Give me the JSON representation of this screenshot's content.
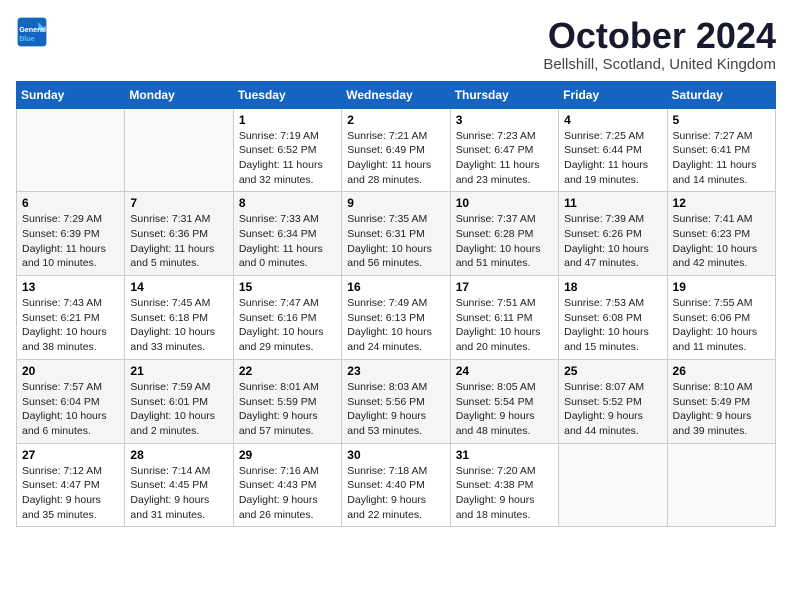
{
  "logo": {
    "line1": "General",
    "line2": "Blue"
  },
  "title": "October 2024",
  "location": "Bellshill, Scotland, United Kingdom",
  "days_of_week": [
    "Sunday",
    "Monday",
    "Tuesday",
    "Wednesday",
    "Thursday",
    "Friday",
    "Saturday"
  ],
  "weeks": [
    [
      {
        "day": "",
        "info": ""
      },
      {
        "day": "",
        "info": ""
      },
      {
        "day": "1",
        "info": "Sunrise: 7:19 AM\nSunset: 6:52 PM\nDaylight: 11 hours\nand 32 minutes."
      },
      {
        "day": "2",
        "info": "Sunrise: 7:21 AM\nSunset: 6:49 PM\nDaylight: 11 hours\nand 28 minutes."
      },
      {
        "day": "3",
        "info": "Sunrise: 7:23 AM\nSunset: 6:47 PM\nDaylight: 11 hours\nand 23 minutes."
      },
      {
        "day": "4",
        "info": "Sunrise: 7:25 AM\nSunset: 6:44 PM\nDaylight: 11 hours\nand 19 minutes."
      },
      {
        "day": "5",
        "info": "Sunrise: 7:27 AM\nSunset: 6:41 PM\nDaylight: 11 hours\nand 14 minutes."
      }
    ],
    [
      {
        "day": "6",
        "info": "Sunrise: 7:29 AM\nSunset: 6:39 PM\nDaylight: 11 hours\nand 10 minutes."
      },
      {
        "day": "7",
        "info": "Sunrise: 7:31 AM\nSunset: 6:36 PM\nDaylight: 11 hours\nand 5 minutes."
      },
      {
        "day": "8",
        "info": "Sunrise: 7:33 AM\nSunset: 6:34 PM\nDaylight: 11 hours\nand 0 minutes."
      },
      {
        "day": "9",
        "info": "Sunrise: 7:35 AM\nSunset: 6:31 PM\nDaylight: 10 hours\nand 56 minutes."
      },
      {
        "day": "10",
        "info": "Sunrise: 7:37 AM\nSunset: 6:28 PM\nDaylight: 10 hours\nand 51 minutes."
      },
      {
        "day": "11",
        "info": "Sunrise: 7:39 AM\nSunset: 6:26 PM\nDaylight: 10 hours\nand 47 minutes."
      },
      {
        "day": "12",
        "info": "Sunrise: 7:41 AM\nSunset: 6:23 PM\nDaylight: 10 hours\nand 42 minutes."
      }
    ],
    [
      {
        "day": "13",
        "info": "Sunrise: 7:43 AM\nSunset: 6:21 PM\nDaylight: 10 hours\nand 38 minutes."
      },
      {
        "day": "14",
        "info": "Sunrise: 7:45 AM\nSunset: 6:18 PM\nDaylight: 10 hours\nand 33 minutes."
      },
      {
        "day": "15",
        "info": "Sunrise: 7:47 AM\nSunset: 6:16 PM\nDaylight: 10 hours\nand 29 minutes."
      },
      {
        "day": "16",
        "info": "Sunrise: 7:49 AM\nSunset: 6:13 PM\nDaylight: 10 hours\nand 24 minutes."
      },
      {
        "day": "17",
        "info": "Sunrise: 7:51 AM\nSunset: 6:11 PM\nDaylight: 10 hours\nand 20 minutes."
      },
      {
        "day": "18",
        "info": "Sunrise: 7:53 AM\nSunset: 6:08 PM\nDaylight: 10 hours\nand 15 minutes."
      },
      {
        "day": "19",
        "info": "Sunrise: 7:55 AM\nSunset: 6:06 PM\nDaylight: 10 hours\nand 11 minutes."
      }
    ],
    [
      {
        "day": "20",
        "info": "Sunrise: 7:57 AM\nSunset: 6:04 PM\nDaylight: 10 hours\nand 6 minutes."
      },
      {
        "day": "21",
        "info": "Sunrise: 7:59 AM\nSunset: 6:01 PM\nDaylight: 10 hours\nand 2 minutes."
      },
      {
        "day": "22",
        "info": "Sunrise: 8:01 AM\nSunset: 5:59 PM\nDaylight: 9 hours\nand 57 minutes."
      },
      {
        "day": "23",
        "info": "Sunrise: 8:03 AM\nSunset: 5:56 PM\nDaylight: 9 hours\nand 53 minutes."
      },
      {
        "day": "24",
        "info": "Sunrise: 8:05 AM\nSunset: 5:54 PM\nDaylight: 9 hours\nand 48 minutes."
      },
      {
        "day": "25",
        "info": "Sunrise: 8:07 AM\nSunset: 5:52 PM\nDaylight: 9 hours\nand 44 minutes."
      },
      {
        "day": "26",
        "info": "Sunrise: 8:10 AM\nSunset: 5:49 PM\nDaylight: 9 hours\nand 39 minutes."
      }
    ],
    [
      {
        "day": "27",
        "info": "Sunrise: 7:12 AM\nSunset: 4:47 PM\nDaylight: 9 hours\nand 35 minutes."
      },
      {
        "day": "28",
        "info": "Sunrise: 7:14 AM\nSunset: 4:45 PM\nDaylight: 9 hours\nand 31 minutes."
      },
      {
        "day": "29",
        "info": "Sunrise: 7:16 AM\nSunset: 4:43 PM\nDaylight: 9 hours\nand 26 minutes."
      },
      {
        "day": "30",
        "info": "Sunrise: 7:18 AM\nSunset: 4:40 PM\nDaylight: 9 hours\nand 22 minutes."
      },
      {
        "day": "31",
        "info": "Sunrise: 7:20 AM\nSunset: 4:38 PM\nDaylight: 9 hours\nand 18 minutes."
      },
      {
        "day": "",
        "info": ""
      },
      {
        "day": "",
        "info": ""
      }
    ]
  ]
}
